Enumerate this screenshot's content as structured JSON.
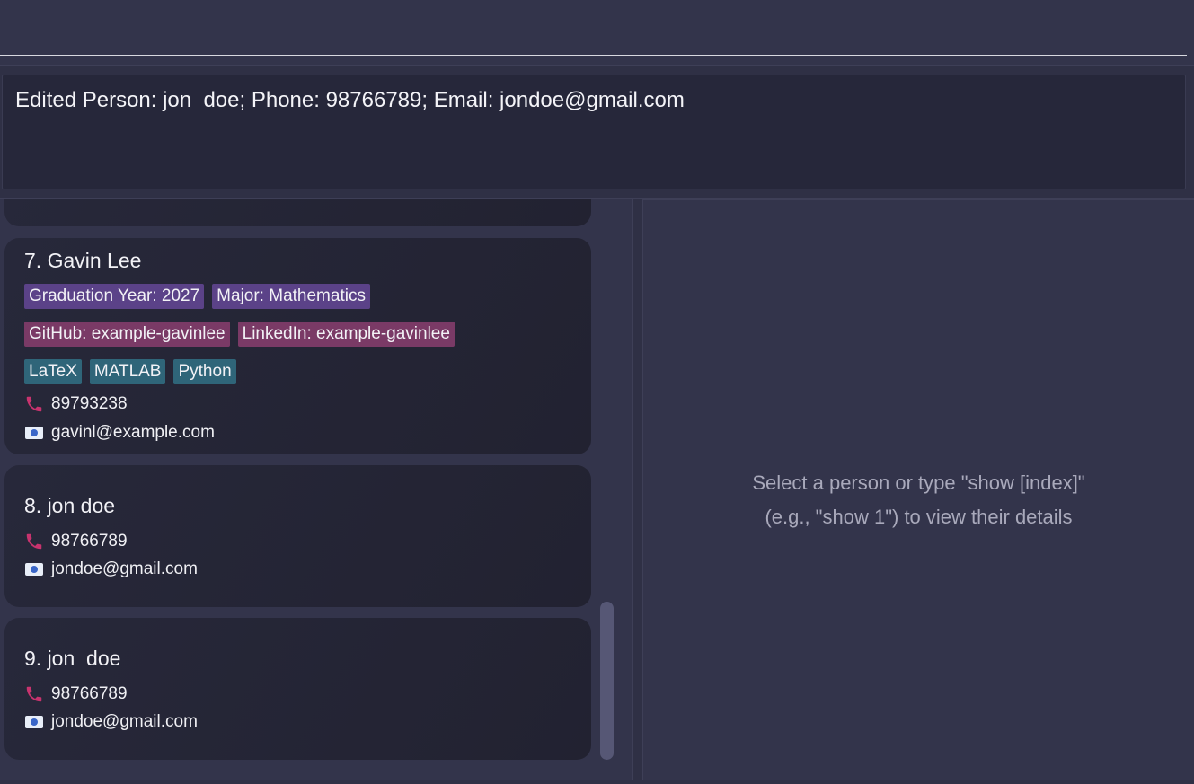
{
  "command_box": {
    "value": ""
  },
  "result_display": {
    "text": "Edited Person: jon  doe; Phone: 98766789; Email: jondoe@gmail.com"
  },
  "person_list": {
    "cards": [
      {
        "name": "7. Gavin Lee",
        "tag_rows": [
          [
            {
              "label": "Graduation Year: 2027",
              "color": "purple"
            },
            {
              "label": "Major: Mathematics",
              "color": "purple"
            }
          ],
          [
            {
              "label": "GitHub: example-gavinlee",
              "color": "pink"
            },
            {
              "label": "LinkedIn: example-gavinlee",
              "color": "pink"
            }
          ],
          [
            {
              "label": "LaTeX",
              "color": "teal"
            },
            {
              "label": "MATLAB",
              "color": "teal"
            },
            {
              "label": "Python",
              "color": "teal"
            }
          ]
        ],
        "phone": "89793238",
        "email": "gavinl@example.com"
      },
      {
        "name": "8. jon doe",
        "phone": "98766789",
        "email": "jondoe@gmail.com"
      },
      {
        "name": "9. jon  doe",
        "phone": "98766789",
        "email": "jondoe@gmail.com"
      }
    ]
  },
  "detail_panel": {
    "placeholder_line1": "Select a person or type \"show [index]\"",
    "placeholder_line2": "(e.g., \"show 1\") to view their details"
  },
  "icons": {
    "phone": "phone-icon",
    "email": "email-icon"
  },
  "colors": {
    "tag_purple": "#5b4288",
    "tag_pink": "#7a3a66",
    "tag_teal": "#2f6579",
    "phone_icon": "#c8336e"
  }
}
